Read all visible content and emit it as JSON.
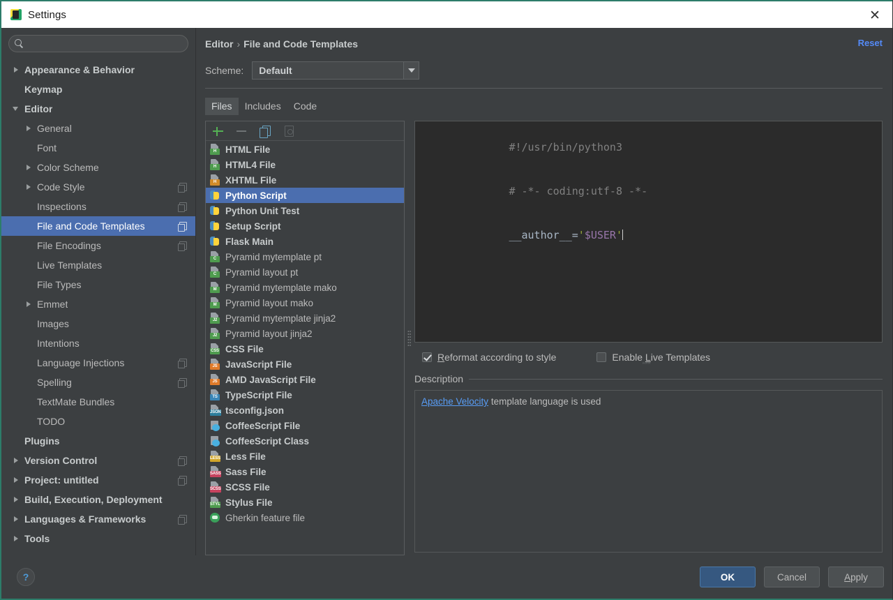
{
  "window": {
    "title": "Settings",
    "app_icon": "settings-app-icon",
    "close_icon": "close-icon"
  },
  "search": {
    "placeholder": "",
    "value": "",
    "icon": "search-icon"
  },
  "sidebar": {
    "items": [
      {
        "label": "Appearance & Behavior",
        "indent": 0,
        "arrow": "closed",
        "bold": true,
        "copy": false,
        "selected": false
      },
      {
        "label": "Keymap",
        "indent": 0,
        "arrow": "none",
        "bold": true,
        "copy": false,
        "selected": false
      },
      {
        "label": "Editor",
        "indent": 0,
        "arrow": "open",
        "bold": true,
        "copy": false,
        "selected": false
      },
      {
        "label": "General",
        "indent": 1,
        "arrow": "closed",
        "bold": false,
        "copy": false,
        "selected": false
      },
      {
        "label": "Font",
        "indent": 1,
        "arrow": "none",
        "bold": false,
        "copy": false,
        "selected": false
      },
      {
        "label": "Color Scheme",
        "indent": 1,
        "arrow": "closed",
        "bold": false,
        "copy": false,
        "selected": false
      },
      {
        "label": "Code Style",
        "indent": 1,
        "arrow": "closed",
        "bold": false,
        "copy": true,
        "selected": false
      },
      {
        "label": "Inspections",
        "indent": 1,
        "arrow": "none",
        "bold": false,
        "copy": true,
        "selected": false
      },
      {
        "label": "File and Code Templates",
        "indent": 1,
        "arrow": "none",
        "bold": false,
        "copy": true,
        "selected": true
      },
      {
        "label": "File Encodings",
        "indent": 1,
        "arrow": "none",
        "bold": false,
        "copy": true,
        "selected": false
      },
      {
        "label": "Live Templates",
        "indent": 1,
        "arrow": "none",
        "bold": false,
        "copy": false,
        "selected": false
      },
      {
        "label": "File Types",
        "indent": 1,
        "arrow": "none",
        "bold": false,
        "copy": false,
        "selected": false
      },
      {
        "label": "Emmet",
        "indent": 1,
        "arrow": "closed",
        "bold": false,
        "copy": false,
        "selected": false
      },
      {
        "label": "Images",
        "indent": 1,
        "arrow": "none",
        "bold": false,
        "copy": false,
        "selected": false
      },
      {
        "label": "Intentions",
        "indent": 1,
        "arrow": "none",
        "bold": false,
        "copy": false,
        "selected": false
      },
      {
        "label": "Language Injections",
        "indent": 1,
        "arrow": "none",
        "bold": false,
        "copy": true,
        "selected": false
      },
      {
        "label": "Spelling",
        "indent": 1,
        "arrow": "none",
        "bold": false,
        "copy": true,
        "selected": false
      },
      {
        "label": "TextMate Bundles",
        "indent": 1,
        "arrow": "none",
        "bold": false,
        "copy": false,
        "selected": false
      },
      {
        "label": "TODO",
        "indent": 1,
        "arrow": "none",
        "bold": false,
        "copy": false,
        "selected": false
      },
      {
        "label": "Plugins",
        "indent": 0,
        "arrow": "none",
        "bold": true,
        "copy": false,
        "selected": false
      },
      {
        "label": "Version Control",
        "indent": 0,
        "arrow": "closed",
        "bold": true,
        "copy": true,
        "selected": false
      },
      {
        "label": "Project: untitled",
        "indent": 0,
        "arrow": "closed",
        "bold": true,
        "copy": true,
        "selected": false
      },
      {
        "label": "Build, Execution, Deployment",
        "indent": 0,
        "arrow": "closed",
        "bold": true,
        "copy": false,
        "selected": false
      },
      {
        "label": "Languages & Frameworks",
        "indent": 0,
        "arrow": "closed",
        "bold": true,
        "copy": true,
        "selected": false
      },
      {
        "label": "Tools",
        "indent": 0,
        "arrow": "closed",
        "bold": true,
        "copy": false,
        "selected": false
      }
    ]
  },
  "main": {
    "breadcrumb_root": "Editor",
    "breadcrumb_sep": "›",
    "breadcrumb_leaf": "File and Code Templates",
    "reset_label": "Reset",
    "scheme_label": "Scheme:",
    "scheme_value": "Default",
    "tabs": [
      {
        "label": "Files",
        "active": true
      },
      {
        "label": "Includes",
        "active": false
      },
      {
        "label": "Code",
        "active": false
      }
    ],
    "toolbar": [
      {
        "name": "add-template-button",
        "icon": "plus-icon",
        "enabled": true
      },
      {
        "name": "remove-template-button",
        "icon": "minus-icon",
        "enabled": false
      },
      {
        "name": "copy-template-button",
        "icon": "copy-icon",
        "enabled": true
      },
      {
        "name": "clone-template-button",
        "icon": "clone-icon",
        "enabled": false
      }
    ],
    "templates": [
      {
        "label": "HTML File",
        "icon": "html-file-icon",
        "badge": "H",
        "badge_color": "#4f9c4f",
        "style": "doc",
        "bold": true,
        "selected": false
      },
      {
        "label": "HTML4 File",
        "icon": "html4-file-icon",
        "badge": "H",
        "badge_color": "#4f9c4f",
        "style": "doc",
        "bold": true,
        "selected": false
      },
      {
        "label": "XHTML File",
        "icon": "xhtml-file-icon",
        "badge": "H",
        "badge_color": "#d18b2a",
        "style": "doc",
        "bold": true,
        "selected": false
      },
      {
        "label": "Python Script",
        "icon": "python-file-icon",
        "badge": "",
        "badge_color": "",
        "style": "python",
        "bold": true,
        "selected": true
      },
      {
        "label": "Python Unit Test",
        "icon": "python-file-icon",
        "badge": "",
        "badge_color": "",
        "style": "python",
        "bold": true,
        "selected": false
      },
      {
        "label": "Setup Script",
        "icon": "python-file-icon",
        "badge": "",
        "badge_color": "",
        "style": "python",
        "bold": true,
        "selected": false
      },
      {
        "label": "Flask Main",
        "icon": "python-file-icon",
        "badge": "",
        "badge_color": "",
        "style": "python",
        "bold": true,
        "selected": false
      },
      {
        "label": "Pyramid mytemplate pt",
        "icon": "chameleon-file-icon",
        "badge": "C",
        "badge_color": "#4f9c4f",
        "style": "doc",
        "bold": false,
        "selected": false
      },
      {
        "label": "Pyramid layout pt",
        "icon": "chameleon-file-icon",
        "badge": "C",
        "badge_color": "#4f9c4f",
        "style": "doc",
        "bold": false,
        "selected": false
      },
      {
        "label": "Pyramid mytemplate mako",
        "icon": "mako-file-icon",
        "badge": "M",
        "badge_color": "#4f9c4f",
        "style": "doc",
        "bold": false,
        "selected": false
      },
      {
        "label": "Pyramid layout mako",
        "icon": "mako-file-icon",
        "badge": "M",
        "badge_color": "#4f9c4f",
        "style": "doc",
        "bold": false,
        "selected": false
      },
      {
        "label": "Pyramid mytemplate jinja2",
        "icon": "jinja2-file-icon",
        "badge": "J2",
        "badge_color": "#4f9c4f",
        "style": "doc",
        "bold": false,
        "selected": false
      },
      {
        "label": "Pyramid layout jinja2",
        "icon": "jinja2-file-icon",
        "badge": "J2",
        "badge_color": "#4f9c4f",
        "style": "doc",
        "bold": false,
        "selected": false
      },
      {
        "label": "CSS File",
        "icon": "css-file-icon",
        "badge": "CSS",
        "badge_color": "#4f9c4f",
        "style": "doc",
        "bold": true,
        "selected": false
      },
      {
        "label": "JavaScript File",
        "icon": "javascript-file-icon",
        "badge": "JS",
        "badge_color": "#e07b2a",
        "style": "doc",
        "bold": true,
        "selected": false
      },
      {
        "label": "AMD JavaScript File",
        "icon": "javascript-file-icon",
        "badge": "JS",
        "badge_color": "#e07b2a",
        "style": "doc",
        "bold": true,
        "selected": false
      },
      {
        "label": "TypeScript File",
        "icon": "typescript-file-icon",
        "badge": "TS",
        "badge_color": "#3a86b8",
        "style": "doc",
        "bold": true,
        "selected": false
      },
      {
        "label": "tsconfig.json",
        "icon": "json-file-icon",
        "badge": "JSON",
        "badge_color": "#2d7f9d",
        "style": "doc",
        "bold": true,
        "selected": false
      },
      {
        "label": "CoffeeScript File",
        "icon": "coffeescript-file-icon",
        "badge": "",
        "badge_color": "",
        "style": "coffee",
        "bold": true,
        "selected": false
      },
      {
        "label": "CoffeeScript Class",
        "icon": "coffeescript-file-icon",
        "badge": "",
        "badge_color": "",
        "style": "coffee",
        "bold": true,
        "selected": false
      },
      {
        "label": "Less File",
        "icon": "less-file-icon",
        "badge": "LESS",
        "badge_color": "#d1a62a",
        "style": "doc",
        "bold": true,
        "selected": false
      },
      {
        "label": "Sass File",
        "icon": "sass-file-icon",
        "badge": "SASS",
        "badge_color": "#c7435f",
        "style": "doc",
        "bold": true,
        "selected": false
      },
      {
        "label": "SCSS File",
        "icon": "scss-file-icon",
        "badge": "SCSS",
        "badge_color": "#c7435f",
        "style": "doc",
        "bold": true,
        "selected": false
      },
      {
        "label": "Stylus File",
        "icon": "stylus-file-icon",
        "badge": "STYL",
        "badge_color": "#4f9c4f",
        "style": "doc",
        "bold": true,
        "selected": false
      },
      {
        "label": "Gherkin feature file",
        "icon": "gherkin-file-icon",
        "badge": "",
        "badge_color": "",
        "style": "gherkin",
        "bold": false,
        "selected": false
      }
    ],
    "code": {
      "line1": "#!/usr/bin/python3",
      "line2": "# -*- coding:utf-8 -*-",
      "line3_name": "__author__=",
      "line3_quote_open": "'",
      "line3_var": "$USER",
      "line3_quote_close": "'"
    },
    "options": {
      "reformat_label_u": "R",
      "reformat_label_rest": "eformat according to style",
      "reformat_checked": true,
      "live_templates_label_pre": "Enable ",
      "live_templates_label_u": "L",
      "live_templates_label_rest": "ive Templates",
      "live_templates_checked": false,
      "quote_hint": "”””"
    },
    "description": {
      "legend": "Description",
      "link": "Apache Velocity",
      "text": " template language is used"
    }
  },
  "footer": {
    "help_glyph": "?",
    "ok_label": "OK",
    "cancel_label": "Cancel",
    "apply_label_u": "A",
    "apply_label_rest": "pply"
  },
  "colors": {
    "window_bg": "#3c3f41",
    "selection": "#4b6eaf",
    "accent_link": "#548af7",
    "code_bg": "#2b2b2b",
    "titlebar_bg": "#ffffff",
    "border_green": "#2d7d6a"
  }
}
